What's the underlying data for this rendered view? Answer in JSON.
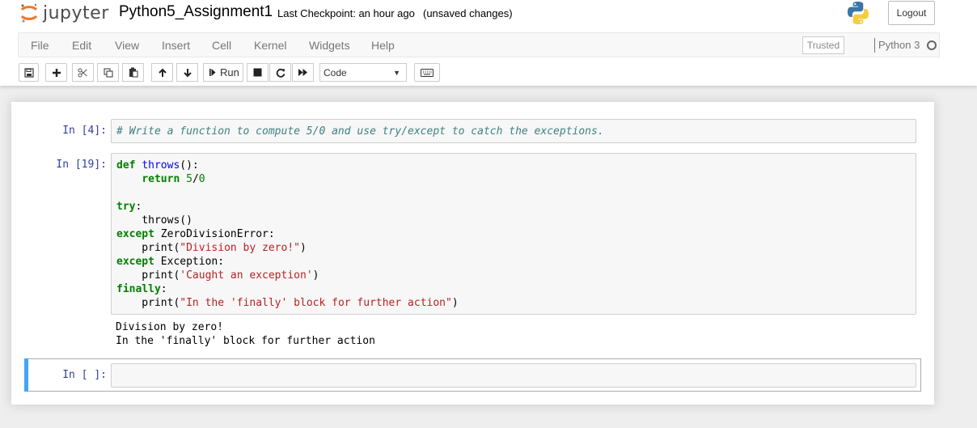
{
  "header": {
    "logo_text": "jupyter",
    "notebook_title": "Python5_Assignment1",
    "checkpoint": "Last Checkpoint: an hour ago",
    "autosave": "(unsaved changes)",
    "logout_label": "Logout",
    "logo_icon": "jupyter-logo-icon",
    "kernel_logo_icon": "python-logo-icon"
  },
  "menubar": {
    "items": [
      "File",
      "Edit",
      "View",
      "Insert",
      "Cell",
      "Kernel",
      "Widgets",
      "Help"
    ],
    "trusted_label": "Trusted",
    "kernel_name": "Python 3"
  },
  "toolbar": {
    "run_label": "Run",
    "cell_type": "Code",
    "icons": [
      "save-icon",
      "plus-icon",
      "cut-icon",
      "copy-icon",
      "paste-icon",
      "arrow-up-icon",
      "arrow-down-icon",
      "step-forward-icon",
      "stop-icon",
      "restart-icon",
      "fast-forward-icon",
      "keyboard-icon"
    ]
  },
  "cells": [
    {
      "prompt": "In [4]:",
      "lines": [
        [
          {
            "t": "# Write a function to compute 5/0 and use try/except to catch the exceptions.",
            "c": "cm"
          }
        ]
      ]
    },
    {
      "prompt": "In [19]:",
      "lines": [
        [
          {
            "t": "def",
            "c": "kw"
          },
          {
            "t": " "
          },
          {
            "t": "throws",
            "c": "fn"
          },
          {
            "t": "():"
          }
        ],
        [
          {
            "t": "    "
          },
          {
            "t": "return",
            "c": "kw"
          },
          {
            "t": " "
          },
          {
            "t": "5",
            "c": "num"
          },
          {
            "t": "/"
          },
          {
            "t": "0",
            "c": "num"
          }
        ],
        [],
        [
          {
            "t": "try",
            "c": "kw"
          },
          {
            "t": ":"
          }
        ],
        [
          {
            "t": "    throws()"
          }
        ],
        [
          {
            "t": "except",
            "c": "kw"
          },
          {
            "t": " ZeroDivisionError:"
          }
        ],
        [
          {
            "t": "    print("
          },
          {
            "t": "\"Division by zero!\"",
            "c": "str"
          },
          {
            "t": ")"
          }
        ],
        [
          {
            "t": "except",
            "c": "kw"
          },
          {
            "t": " Exception:"
          }
        ],
        [
          {
            "t": "    print("
          },
          {
            "t": "'Caught an exception'",
            "c": "str"
          },
          {
            "t": ")"
          }
        ],
        [
          {
            "t": "finally",
            "c": "kw"
          },
          {
            "t": ":"
          }
        ],
        [
          {
            "t": "    print("
          },
          {
            "t": "\"In the 'finally' block for further action\"",
            "c": "str"
          },
          {
            "t": ")"
          }
        ]
      ],
      "output": [
        "Division by zero!",
        "In the 'finally' block for further action"
      ]
    },
    {
      "prompt": "In [ ]:",
      "lines": []
    }
  ],
  "colors": {
    "prompt_blue": "#303f9f",
    "selected_bar": "#42a5f5",
    "keyword": "#008000",
    "string": "#ba2121",
    "comment": "#408080",
    "function": "#0000ff"
  }
}
